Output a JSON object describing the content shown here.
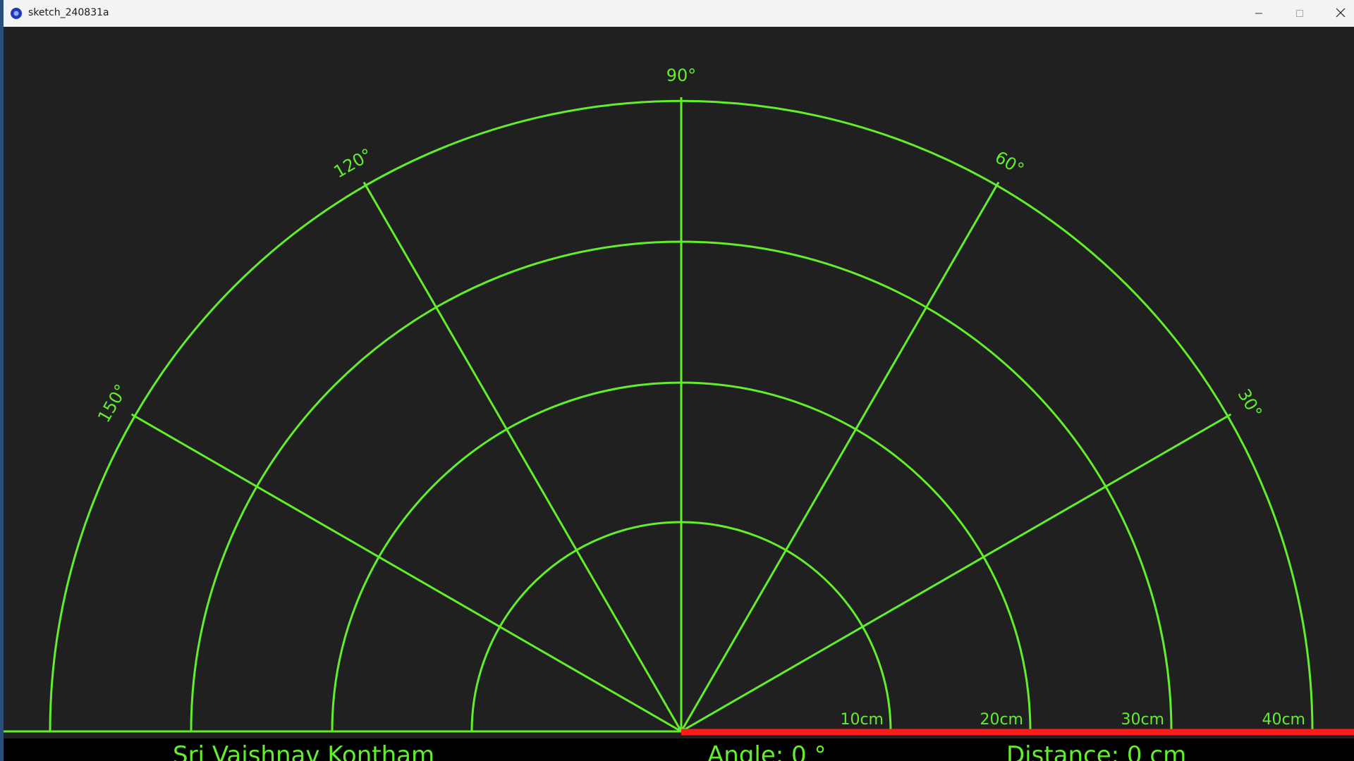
{
  "window": {
    "title": "sketch_240831a",
    "controls": {
      "minimize": "minimize-icon",
      "maximize": "maximize-icon",
      "close": "close-icon"
    }
  },
  "colors": {
    "background": "#202020",
    "grid": "#62ee2b",
    "sweep": "#ff1a1a",
    "footer": "#000000",
    "titlebar": "#f3f3f3"
  },
  "radar": {
    "angle_labels": [
      "30°",
      "60°",
      "90°",
      "120°",
      "150°"
    ],
    "range_labels": [
      "10cm",
      "20cm",
      "30cm",
      "40cm"
    ],
    "current_angle_deg": 0
  },
  "footer": {
    "author": "Sri Vaishnav Kontham",
    "angle": "Angle: 0 °",
    "distance": "Distance: 0 cm"
  }
}
